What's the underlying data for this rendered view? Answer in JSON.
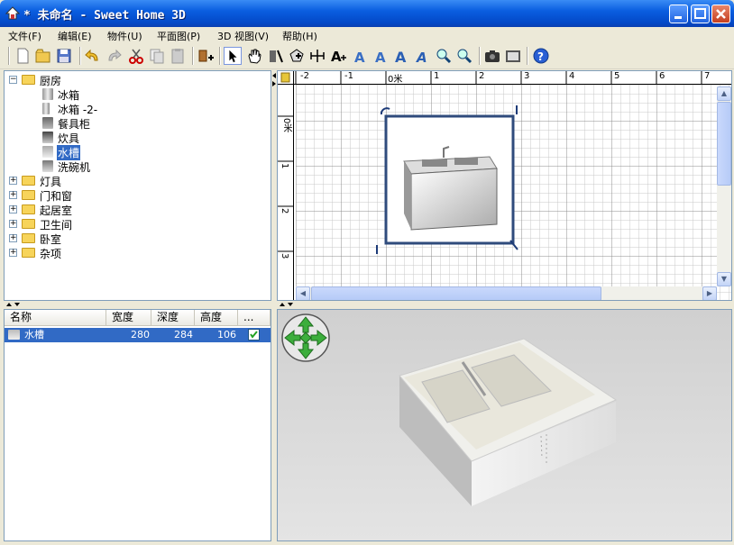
{
  "window": {
    "title": "* 未命名 - Sweet Home 3D"
  },
  "menu": [
    "文件(F)",
    "编辑(E)",
    "物件(U)",
    "平面图(P)",
    "3D 视图(V)",
    "帮助(H)"
  ],
  "toolbar_icons": [
    "new-icon",
    "open-icon",
    "save-icon",
    "undo-icon",
    "redo-icon",
    "cut-icon",
    "copy-icon",
    "paste-icon",
    "add-furniture-icon",
    "select-icon",
    "pan-icon",
    "create-walls-icon",
    "create-rooms-icon",
    "create-dimensions-icon",
    "add-text-icon",
    "text-style-a1-icon",
    "text-style-a2-icon",
    "text-style-a3-icon",
    "text-style-a4-icon",
    "zoom-in-icon",
    "zoom-out-icon",
    "camera-icon",
    "photo-icon",
    "help-icon"
  ],
  "catalog": {
    "root": "厨房",
    "children": [
      "冰箱",
      "冰箱 -2-",
      "餐具柜",
      "炊具",
      "水槽",
      "洗碗机"
    ],
    "selected": "水槽",
    "categories": [
      "灯具",
      "门和窗",
      "起居室",
      "卫生间",
      "卧室",
      "杂项"
    ]
  },
  "table": {
    "headers": [
      "名称",
      "宽度",
      "深度",
      "高度",
      "..."
    ],
    "rows": [
      {
        "name": "水槽",
        "width": "280",
        "depth": "284",
        "height": "106",
        "visible": true
      }
    ]
  },
  "plan": {
    "ruler_x": [
      "-2",
      "-1",
      "0米",
      "1",
      "2",
      "3",
      "4",
      "5",
      "6",
      "7"
    ],
    "ruler_y": [
      "0米",
      "1",
      "2",
      "3"
    ]
  }
}
